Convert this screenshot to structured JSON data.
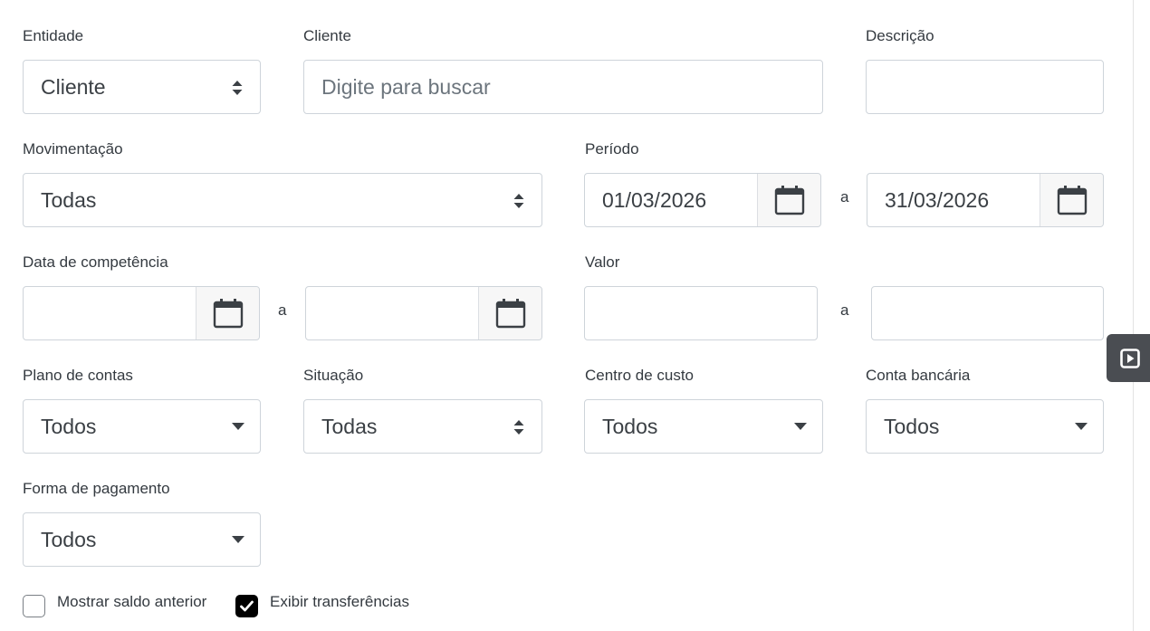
{
  "form": {
    "entidade": {
      "label": "Entidade",
      "value": "Cliente"
    },
    "cliente": {
      "label": "Cliente",
      "placeholder": "Digite para buscar",
      "value": ""
    },
    "descricao": {
      "label": "Descrição",
      "value": ""
    },
    "movimentacao": {
      "label": "Movimentação",
      "value": "Todas"
    },
    "periodo": {
      "label": "Período",
      "start": "01/03/2026",
      "separator": "a",
      "end": "31/03/2026"
    },
    "data_competencia": {
      "label": "Data de competência",
      "start": "",
      "separator": "a",
      "end": ""
    },
    "valor": {
      "label": "Valor",
      "min": "",
      "separator": "a",
      "max": ""
    },
    "plano_contas": {
      "label": "Plano de contas",
      "value": "Todos"
    },
    "situacao": {
      "label": "Situação",
      "value": "Todas"
    },
    "centro_custo": {
      "label": "Centro de custo",
      "value": "Todos"
    },
    "conta_bancaria": {
      "label": "Conta bancária",
      "value": "Todos"
    },
    "forma_pagamento": {
      "label": "Forma de pagamento",
      "value": "Todos"
    },
    "mostrar_saldo_anterior": {
      "label": "Mostrar saldo anterior",
      "checked": false
    },
    "exibir_transferencias": {
      "label": "Exibir transferências",
      "checked": true
    }
  },
  "icons": {
    "calendar": "calendar-icon",
    "sort_caret": "sort-caret-icon",
    "dropdown_caret": "caret-down-icon",
    "side_panel": "play-square-icon"
  },
  "colors": {
    "border": "#ced4da",
    "text": "#3b4045",
    "side_tab": "#4a4d52",
    "checkbox_checked": "#000000"
  }
}
